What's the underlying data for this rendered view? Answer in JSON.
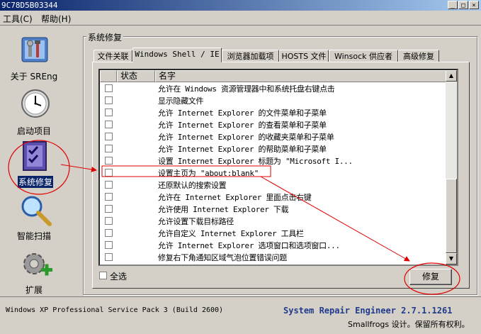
{
  "window": {
    "title": "9C78D5B03344",
    "minimize": "_",
    "maximize": "□",
    "close": "×"
  },
  "menu": {
    "tools": "工具(C)",
    "help": "帮助(H)"
  },
  "sidebar": {
    "items": [
      {
        "label": "关于 SREng",
        "icon": "toolbox-icon"
      },
      {
        "label": "启动项目",
        "icon": "clock-icon"
      },
      {
        "label": "系统修复",
        "icon": "checklist-icon"
      },
      {
        "label": "智能扫描",
        "icon": "magnifier-icon"
      },
      {
        "label": "扩展",
        "icon": "gear-plus-icon"
      }
    ]
  },
  "group": {
    "title": "系统修复"
  },
  "tabs": [
    {
      "label": "文件关联"
    },
    {
      "label": "Windows Shell / IE"
    },
    {
      "label": "浏览器加载项"
    },
    {
      "label": "HOSTS 文件"
    },
    {
      "label": "Winsock 供应者"
    },
    {
      "label": "高级修复"
    }
  ],
  "columns": {
    "status": "状态",
    "name": "名字"
  },
  "rows": [
    "允许在 Windows 资源管理器中和系统托盘右键点击",
    "显示隐藏文件",
    "允许 Internet Explorer 的文件菜单和子菜单",
    "允许 Internet Explorer 的查看菜单和子菜单",
    "允许 Internet Explorer 的收藏夹菜单和子菜单",
    "允许 Internet Explorer 的帮助菜单和子菜单",
    "设置 Internet Explorer 标题为 \"Microsoft I...",
    "设置主页为 \"about:blank\"",
    "还原默认的搜索设置",
    "允许在 Internet Explorer 里面点击右键",
    "允许使用 Internet Explorer 下载",
    "允许设置下载目标路径",
    "允许自定义 Internet Explorer 工具栏",
    "允许 Internet Explorer 选项窗口和选项窗口...",
    "修复右下角通知区域气泡位置错误问题"
  ],
  "select_all": "全选",
  "repair_button": "修复",
  "status": {
    "os": "Windows XP Professional Service Pack 3 (Build 2600)",
    "app": "System Repair Engineer 2.7.1.1261",
    "copyright": "Smallfrogs 设计。保留所有权利。"
  },
  "colors": {
    "annotation": "#e00000",
    "title_blue": "#0a246a",
    "app_name": "#1f3c8c"
  }
}
